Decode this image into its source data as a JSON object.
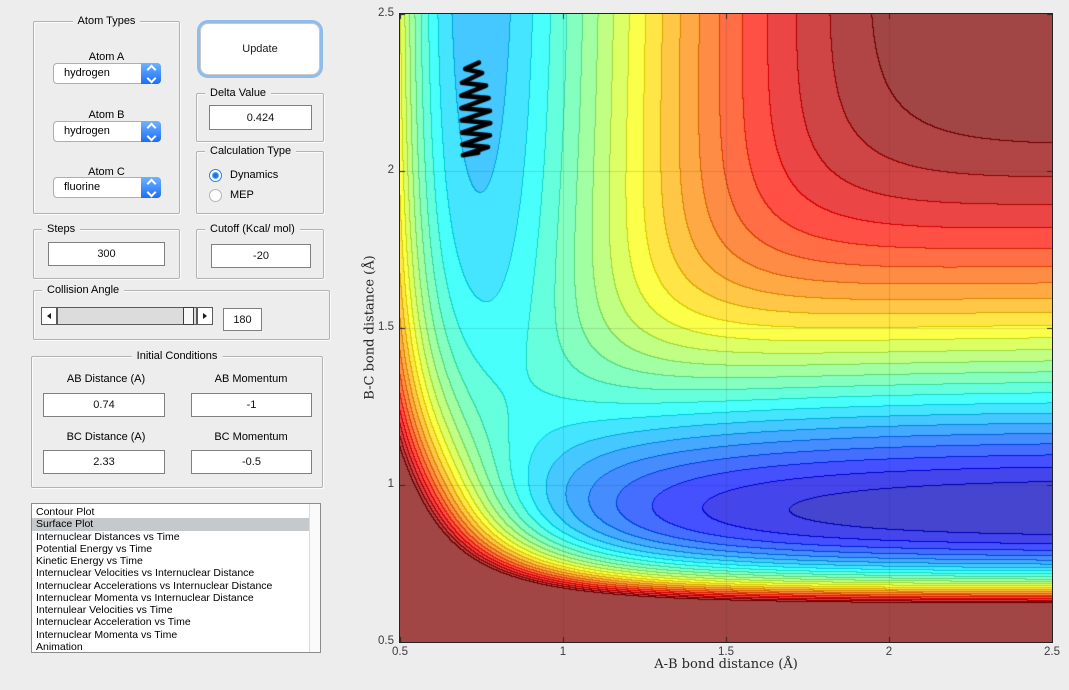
{
  "window": {
    "background": "#EDEDED"
  },
  "controls": {
    "atom_types": {
      "title": "Atom Types",
      "fields": [
        {
          "label": "Atom A",
          "value": "hydrogen"
        },
        {
          "label": "Atom B",
          "value": "hydrogen"
        },
        {
          "label": "Atom C",
          "value": "fluorine"
        }
      ]
    },
    "update_button": {
      "label": "Update"
    },
    "delta_value": {
      "title": "Delta Value",
      "value": "0.424"
    },
    "calculation_type": {
      "title": "Calculation Type",
      "options": [
        {
          "label": "Dynamics",
          "selected": true
        },
        {
          "label": "MEP",
          "selected": false
        }
      ]
    },
    "steps": {
      "title": "Steps",
      "value": "300"
    },
    "cutoff": {
      "title": "Cutoff (Kcal/ mol)",
      "value": "-20"
    },
    "collision_angle": {
      "title": "Collision Angle",
      "value": "180",
      "slider_position": 0.93
    },
    "initial_conditions": {
      "title": "Initial Conditions",
      "fields": [
        {
          "label": "AB Distance (A)",
          "value": "0.74"
        },
        {
          "label": "AB Momentum",
          "value": "-1"
        },
        {
          "label": "BC Distance (A)",
          "value": "2.33"
        },
        {
          "label": "BC Momentum",
          "value": "-0.5"
        }
      ]
    }
  },
  "listbox": {
    "selected_index": 1,
    "items": [
      "Contour Plot",
      "Surface Plot",
      "Internuclear Distances vs Time",
      "Potential Energy vs Time",
      "Kinetic Energy vs Time",
      "Internuclear Velocities vs Internuclear Distance",
      "Internuclear Accelerations vs Internuclear Distance",
      "Internuclear Momenta vs Internuclear Distance",
      "Internulear Velocities vs Time",
      "Internuclear Acceleration vs Time",
      "Internuclear Momenta vs Time",
      "Animation"
    ]
  },
  "chart_data": {
    "type": "heatmap",
    "subtype": "filled-contour potential energy surface, jet colormap lightened 25%, viewed from above",
    "xlabel": "A-B bond distance (Å)",
    "ylabel": "B-C bond distance (Å)",
    "x_range": [
      0.5,
      2.5
    ],
    "y_range": [
      0.5,
      2.5
    ],
    "x_ticks": [
      "0.5",
      "1",
      "1.5",
      "2",
      "2.5"
    ],
    "y_ticks": [
      "0.5",
      "1",
      "1.5",
      "2",
      "2.5"
    ],
    "grid": true,
    "grid_color": "rgba(40,40,40,0.14)",
    "levels": {
      "min": -145,
      "max": -20,
      "step": 5,
      "units": "kcal/mol",
      "clip_above_max_to_top_color": true
    },
    "surface_model": "Collinear LEPS potential energy surface for H + H-F (A=hydrogen, B=hydrogen, C=fluorine)",
    "leps": {
      "sato": 0,
      "pairs": {
        "AB": {
          "D": 109.5,
          "beta": 1.942,
          "re": 0.742
        },
        "BC": {
          "D": 140.9,
          "beta": 2.219,
          "re": 0.917
        },
        "AC": {
          "D": 140.9,
          "beta": 2.219,
          "re": 0.917
        }
      }
    },
    "features": {
      "entrance_channel": "vertical light-blue valley near A-B = 0.74 Å (~ -109 kcal/mol)",
      "product_valley": "horizontal dark-blue valley near B-C = 0.92 Å (~ -140 kcal/mol)",
      "plateau": "dark-red clipped region (V > -20 kcal/mol) at small distances and large-large corner"
    },
    "trajectory": {
      "color": "#000000",
      "line_width": 4.6,
      "description": "black zigzag trajectory: A-B vibration while B-C shrinks",
      "points": [
        [
          0.742,
          2.345
        ],
        [
          0.7,
          2.325
        ],
        [
          0.752,
          2.312
        ],
        [
          0.69,
          2.281
        ],
        [
          0.764,
          2.272
        ],
        [
          0.688,
          2.24
        ],
        [
          0.772,
          2.232
        ],
        [
          0.688,
          2.2
        ],
        [
          0.776,
          2.192
        ],
        [
          0.689,
          2.161
        ],
        [
          0.777,
          2.153
        ],
        [
          0.69,
          2.122
        ],
        [
          0.776,
          2.114
        ],
        [
          0.691,
          2.084
        ],
        [
          0.77,
          2.076
        ],
        [
          0.693,
          2.05
        ],
        [
          0.74,
          2.058
        ]
      ]
    }
  }
}
